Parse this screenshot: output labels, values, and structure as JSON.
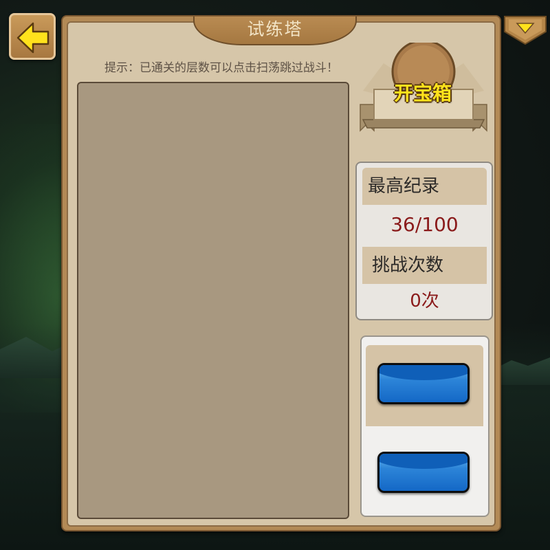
{
  "title": "试练塔",
  "hint": "提示：已通关的层数可以点击扫荡跳过战斗！",
  "chest": {
    "label": "开宝箱"
  },
  "stats": {
    "best_record_label": "最高纪录",
    "best_record_value": "36/100",
    "challenge_count_label": "挑战次数",
    "challenge_count_value": "0次"
  },
  "actions": {
    "button1_label": "",
    "button2_label": ""
  },
  "colors": {
    "panel_bg": "#d6c6a9",
    "panel_border": "#b38a56",
    "accent_yellow": "#ffe21c",
    "stat_value_red": "#8a1a1a",
    "button_blue": "#1468c6"
  },
  "icons": {
    "back": "arrow-left-icon",
    "menu": "triangle-down-icon"
  }
}
